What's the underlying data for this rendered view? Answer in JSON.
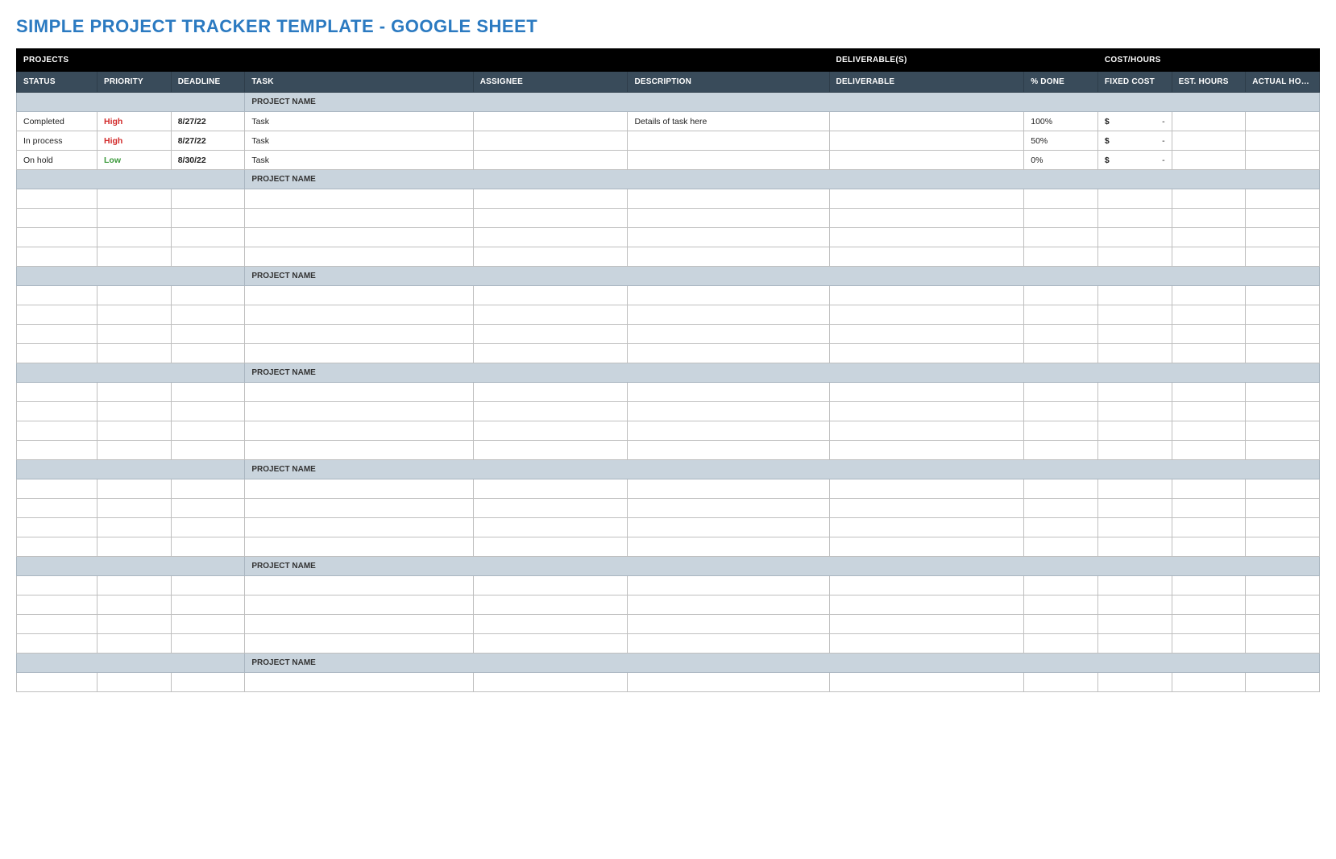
{
  "title": "SIMPLE PROJECT TRACKER TEMPLATE - GOOGLE SHEET",
  "topBand": {
    "projects": "PROJECTS",
    "deliverables": "DELIVERABLE(S)",
    "costHours": "COST/HOURS"
  },
  "headers": {
    "status": "STATUS",
    "priority": "PRIORITY",
    "deadline": "DEADLINE",
    "task": "TASK",
    "assignee": "ASSIGNEE",
    "description": "DESCRIPTION",
    "deliverable": "DELIVERABLE",
    "done": "% DONE",
    "fixed": "FIXED COST",
    "est": "EST. HOURS",
    "act": "ACTUAL HOURS"
  },
  "sectionLabel": "PROJECT NAME",
  "currency": "$",
  "dash": "-",
  "projects": [
    {
      "rows": [
        {
          "status": "Completed",
          "priority": "High",
          "priorityClass": "high",
          "deadline": "8/27/22",
          "task": "Task",
          "assignee": "",
          "description": "Details of task here",
          "deliverable": "",
          "done": "100%",
          "fixedCost": "-",
          "est": "",
          "act": ""
        },
        {
          "status": "In process",
          "priority": "High",
          "priorityClass": "high",
          "deadline": "8/27/22",
          "task": "Task",
          "assignee": "",
          "description": "",
          "deliverable": "",
          "done": "50%",
          "fixedCost": "-",
          "est": "",
          "act": ""
        },
        {
          "status": "On hold",
          "priority": "Low",
          "priorityClass": "low",
          "deadline": "8/30/22",
          "task": "Task",
          "assignee": "",
          "description": "",
          "deliverable": "",
          "done": "0%",
          "fixedCost": "-",
          "est": "",
          "act": ""
        }
      ]
    },
    {
      "rows": [
        {},
        {},
        {},
        {}
      ]
    },
    {
      "rows": [
        {},
        {},
        {},
        {}
      ]
    },
    {
      "rows": [
        {},
        {},
        {},
        {}
      ]
    },
    {
      "rows": [
        {},
        {},
        {},
        {}
      ]
    },
    {
      "rows": [
        {},
        {},
        {},
        {}
      ]
    },
    {
      "rows": [
        {}
      ]
    }
  ]
}
